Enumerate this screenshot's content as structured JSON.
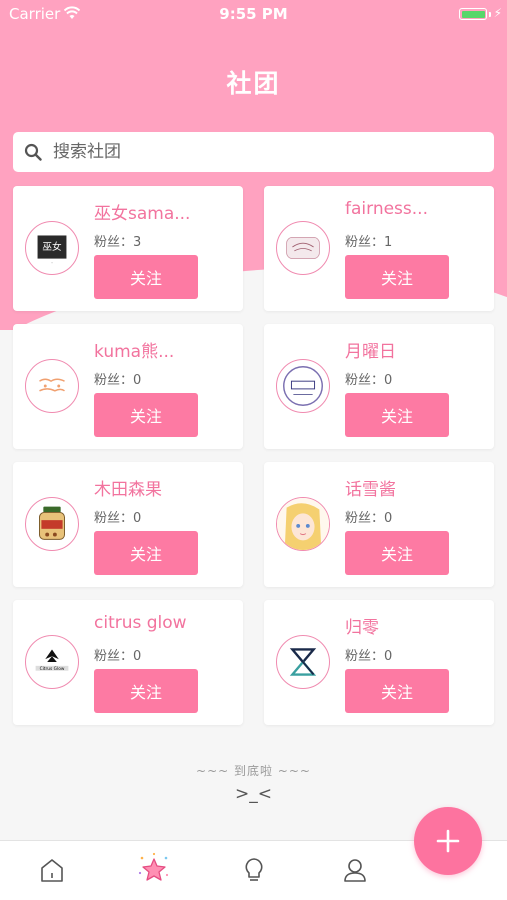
{
  "status_bar": {
    "carrier": "Carrier",
    "time": "9:55 PM"
  },
  "header": {
    "title": "社团"
  },
  "search": {
    "placeholder": "搜索社团"
  },
  "clubs": [
    {
      "name": "巫女sama...",
      "fans": "粉丝：3",
      "button": "关注",
      "avatar": "witch-logo"
    },
    {
      "name": "fairness...",
      "fans": "粉丝：1",
      "button": "关注",
      "avatar": "fairness-logo"
    },
    {
      "name": "kuma熊...",
      "fans": "粉丝：0",
      "button": "关注",
      "avatar": "kuma-logo"
    },
    {
      "name": "月曜日",
      "fans": "粉丝：0",
      "button": "关注",
      "avatar": "monday-logo"
    },
    {
      "name": "木田森果",
      "fans": "粉丝：0",
      "button": "关注",
      "avatar": "jar-logo"
    },
    {
      "name": "话雪酱",
      "fans": "粉丝：0",
      "button": "关注",
      "avatar": "anime-girl-logo"
    },
    {
      "name": "citrus glow",
      "fans": "粉丝：0",
      "button": "关注",
      "avatar": "citrus-glow-logo"
    },
    {
      "name": "归零",
      "fans": "粉丝：0",
      "button": "关注",
      "avatar": "hourglass-logo"
    }
  ],
  "footer": {
    "end_text": "~~~ 到底啦 ~~~",
    "face": ">_<"
  },
  "colors": {
    "brand_pink": "#ffa2c0",
    "button_pink": "#fd7aa3",
    "name_pink": "#f2739e"
  },
  "tabbar": {
    "icons": [
      "home-icon",
      "star-icon",
      "lightbulb-icon",
      "user-icon"
    ],
    "active": "star-icon"
  },
  "fab": {
    "icon": "plus-icon"
  }
}
